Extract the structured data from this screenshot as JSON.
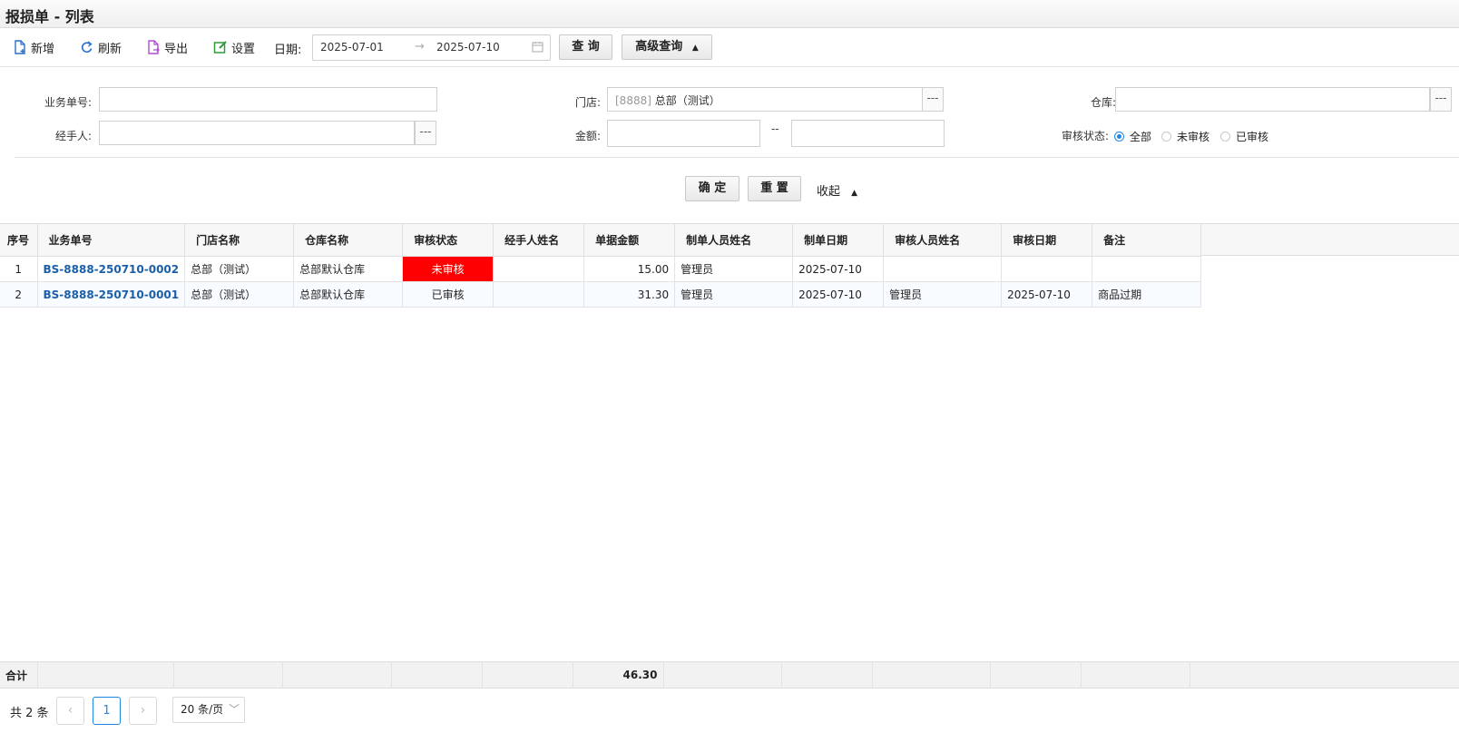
{
  "title": "报损单 - 列表",
  "toolbar": {
    "add": "新增",
    "refresh": "刷新",
    "export": "导出",
    "settings": "设置",
    "date_label": "日期:",
    "date_from": "2025-07-01",
    "date_arrow": "→",
    "date_to": "2025-07-10",
    "query": "查 询",
    "advanced": "高级查询"
  },
  "filters": {
    "doc_no_label": "业务单号:",
    "doc_no_value": "",
    "store_label": "门店:",
    "store_code": "[8888]",
    "store_name": "总部（测试）",
    "warehouse_label": "仓库:",
    "warehouse_value": "",
    "handler_label": "经手人:",
    "handler_value": "",
    "amount_label": "金额:",
    "amount_sep": "--",
    "amount_from": "",
    "amount_to": "",
    "status_label": "审核状态:",
    "status_options": [
      "全部",
      "未审核",
      "已审核"
    ],
    "status_selected": "全部",
    "dots": "---"
  },
  "actions": {
    "confirm": "确 定",
    "reset": "重 置",
    "collapse": "收起"
  },
  "table": {
    "columns": [
      "序号",
      "业务单号",
      "门店名称",
      "仓库名称",
      "审核状态",
      "经手人姓名",
      "单据金额",
      "制单人员姓名",
      "制单日期",
      "审核人员姓名",
      "审核日期",
      "备注"
    ],
    "rows": [
      {
        "idx": "1",
        "doc_no": "BS-8888-250710-0002",
        "store": "总部（测试）",
        "warehouse": "总部默认仓库",
        "status": "未审核",
        "handler": "",
        "amount": "15.00",
        "creator": "管理员",
        "created": "2025-07-10",
        "auditor": "",
        "audited": "",
        "remark": ""
      },
      {
        "idx": "2",
        "doc_no": "BS-8888-250710-0001",
        "store": "总部（测试）",
        "warehouse": "总部默认仓库",
        "status": "已审核",
        "handler": "",
        "amount": "31.30",
        "creator": "管理员",
        "created": "2025-07-10",
        "auditor": "管理员",
        "audited": "2025-07-10",
        "remark": "商品过期"
      }
    ],
    "total_label": "合计",
    "total_amount": "46.30"
  },
  "pager": {
    "total_text": "共 2 条",
    "current_page": "1",
    "page_size": "20 条/页"
  },
  "colors": {
    "accent": "#1e88e5",
    "link": "#1a5fa8",
    "status_unaudited": "#ff0000"
  }
}
